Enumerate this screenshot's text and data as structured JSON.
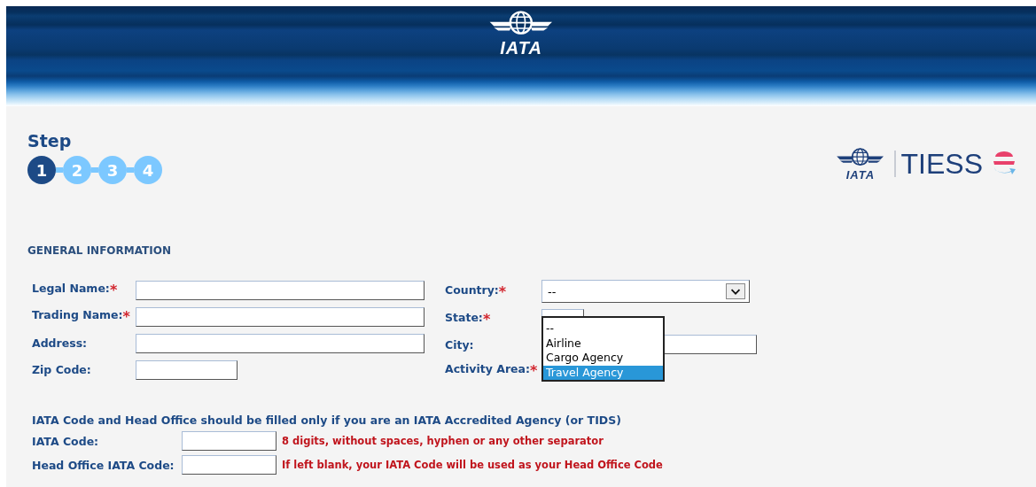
{
  "header": {
    "logo_text": "IATA"
  },
  "steps": {
    "title": "Step",
    "items": [
      {
        "label": "1",
        "selected": true
      },
      {
        "label": "2",
        "selected": false
      },
      {
        "label": "3",
        "selected": false
      },
      {
        "label": "4",
        "selected": false
      }
    ]
  },
  "brand": {
    "logo_text": "IATA",
    "name": "TIESS"
  },
  "section_title": "GENERAL INFORMATION",
  "left_fields": [
    {
      "label": "Legal Name:",
      "mark": "*",
      "kind": "text"
    },
    {
      "label": "Trading Name:",
      "mark": "*",
      "kind": "text"
    },
    {
      "label": "Address:",
      "kind": "text"
    },
    {
      "label": "Zip Code:",
      "kind": "short"
    }
  ],
  "right_fields": [
    {
      "label": "Country:",
      "mark": "*",
      "kind": "select",
      "value": "--"
    },
    {
      "label": "State:",
      "mark": "*",
      "kind": "small-select"
    },
    {
      "label": "City:",
      "kind": "text"
    },
    {
      "label": "Activity Area:",
      "mark": "*",
      "kind": "covered"
    }
  ],
  "open_list": {
    "options": [
      {
        "label": "--",
        "selected": false
      },
      {
        "label": "Airline",
        "selected": false
      },
      {
        "label": "Cargo Agency",
        "selected": false
      },
      {
        "label": "Travel Agency",
        "selected": true
      }
    ]
  },
  "iata_note": "IATA Code and Head Office should be filled only if you are an IATA Accredited Agency (or TIDS)",
  "code_fields": [
    {
      "label": "IATA Code:",
      "hint": "8 digits, without spaces, hyphen or any other separator"
    },
    {
      "label": "Head Office IATA Code:",
      "hint": "If left blank, your IATA Code will be used as your Head Office Code"
    }
  ]
}
